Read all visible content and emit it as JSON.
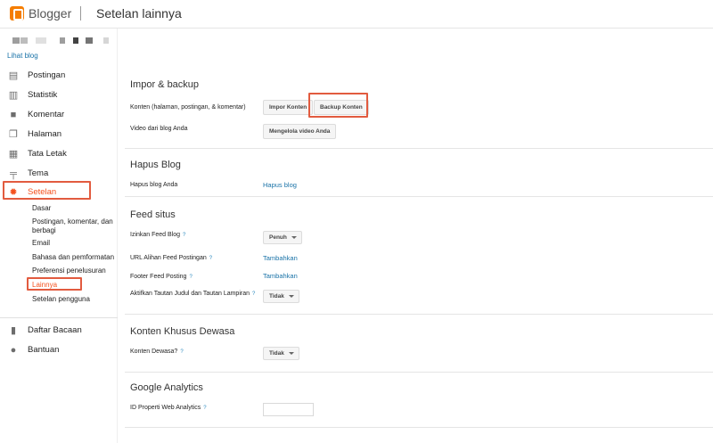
{
  "header": {
    "brand": "Blogger",
    "title": "Setelan lainnya"
  },
  "sidebar": {
    "view_blog": "Lihat blog",
    "items": [
      {
        "label": "Postingan",
        "icon": "posts-icon"
      },
      {
        "label": "Statistik",
        "icon": "stats-icon"
      },
      {
        "label": "Komentar",
        "icon": "comment-icon"
      },
      {
        "label": "Halaman",
        "icon": "pages-icon"
      },
      {
        "label": "Tata Letak",
        "icon": "layout-icon"
      },
      {
        "label": "Tema",
        "icon": "theme-icon"
      },
      {
        "label": "Setelan",
        "icon": "gear-icon"
      }
    ],
    "sub_items": [
      "Dasar",
      "Postingan, komentar, dan berbagi",
      "Email",
      "Bahasa dan pemformatan",
      "Preferensi penelusuran",
      "Lainnya",
      "Setelan pengguna"
    ],
    "bottom_items": [
      {
        "label": "Daftar Bacaan",
        "icon": "bookmark-icon"
      },
      {
        "label": "Bantuan",
        "icon": "help-icon"
      }
    ],
    "accent": "#f4511e"
  },
  "sections": {
    "import_backup": {
      "title": "Impor & backup",
      "content_label": "Konten (halaman, postingan, & komentar)",
      "import_button": "Impor Konten",
      "backup_button": "Backup Konten",
      "video_label": "Video dari blog Anda",
      "video_button": "Mengelola video Anda"
    },
    "delete_blog": {
      "title": "Hapus Blog",
      "label": "Hapus blog Anda",
      "link": "Hapus blog"
    },
    "feed": {
      "title": "Feed situs",
      "allow_label": "Izinkan Feed Blog",
      "allow_value": "Penuh",
      "redirect_label": "URL Alihan Feed Postingan",
      "redirect_link": "Tambahkan",
      "footer_label": "Footer Feed Posting",
      "footer_link": "Tambahkan",
      "enclosure_label": "Aktifkan Tautan Judul dan Tautan Lampiran",
      "enclosure_value": "Tidak"
    },
    "adult": {
      "title": "Konten Khusus Dewasa",
      "label": "Konten Dewasa?",
      "value": "Tidak"
    },
    "analytics": {
      "title": "Google Analytics",
      "label": "ID Properti Web Analytics",
      "value": ""
    },
    "help_mark": "?"
  }
}
